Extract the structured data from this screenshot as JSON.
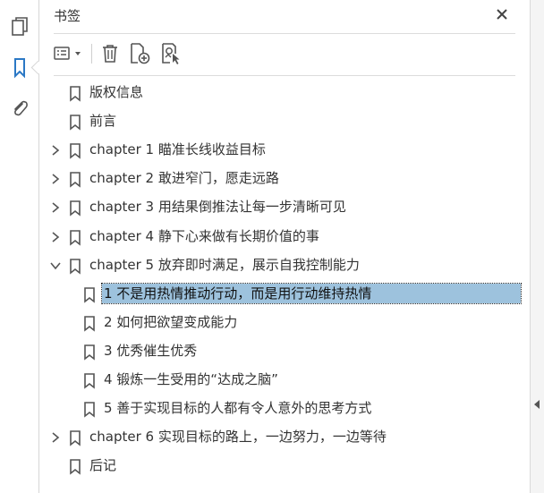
{
  "panel": {
    "title": "书签"
  },
  "rail": {
    "items": [
      {
        "name": "pages-icon",
        "active": false
      },
      {
        "name": "bookmark-icon",
        "active": true
      },
      {
        "name": "attachment-icon",
        "active": false
      }
    ]
  },
  "toolbar": {
    "items": [
      "options-menu-icon",
      "delete-icon",
      "new-bookmark-icon",
      "new-bookmark-from-structure-icon"
    ]
  },
  "colors": {
    "accent": "#2b78c5",
    "selection": "#9dc2dd",
    "text": "#333333"
  },
  "bookmarks": [
    {
      "label": "版权信息",
      "level": 0,
      "chevron": "none"
    },
    {
      "label": "前言",
      "level": 0,
      "chevron": "none"
    },
    {
      "label": "chapter 1 瞄准长线收益目标",
      "level": 0,
      "chevron": "collapsed"
    },
    {
      "label": "chapter 2 敢进窄门，愿走远路",
      "level": 0,
      "chevron": "collapsed"
    },
    {
      "label": "chapter 3 用结果倒推法让每一步清晰可见",
      "level": 0,
      "chevron": "collapsed"
    },
    {
      "label": "chapter 4 静下心来做有长期价值的事",
      "level": 0,
      "chevron": "collapsed"
    },
    {
      "label": "chapter 5 放弃即时满足，展示自我控制能力",
      "level": 0,
      "chevron": "expanded"
    },
    {
      "label": "1 不是用热情推动行动，而是用行动维持热情",
      "level": 1,
      "chevron": "none",
      "selected": true
    },
    {
      "label": "2 如何把欲望变成能力",
      "level": 1,
      "chevron": "none"
    },
    {
      "label": "3 优秀催生优秀",
      "level": 1,
      "chevron": "none"
    },
    {
      "label": "4 锻炼一生受用的“达成之脑”",
      "level": 1,
      "chevron": "none"
    },
    {
      "label": "5 善于实现目标的人都有令人意外的思考方式",
      "level": 1,
      "chevron": "none"
    },
    {
      "label": "chapter 6 实现目标的路上，一边努力，一边等待",
      "level": 0,
      "chevron": "collapsed"
    },
    {
      "label": "后记",
      "level": 0,
      "chevron": "none"
    }
  ]
}
